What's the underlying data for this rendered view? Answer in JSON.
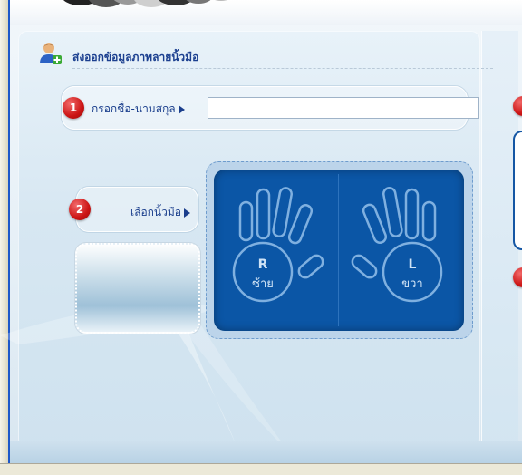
{
  "section": {
    "title": "ส่งออกข้อมูลภาพลายนิ้วมือ"
  },
  "step1": {
    "number": "1",
    "label": "กรอกชื่อ-นามสกุล",
    "input_value": ""
  },
  "step2": {
    "number": "2",
    "label": "เลือกนิ้วมือ"
  },
  "hands": {
    "right_letter": "R",
    "right_label": "ซ้าย",
    "left_letter": "L",
    "left_label": "ขวา"
  },
  "colors": {
    "badge": "#cc1515",
    "hand_panel": "#0b56a6",
    "title": "#1b3f8f"
  }
}
